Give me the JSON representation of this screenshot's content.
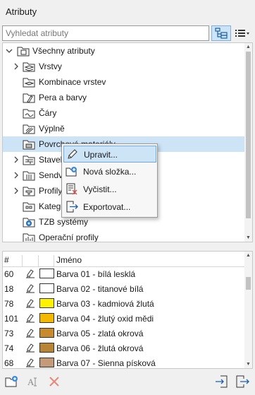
{
  "window": {
    "title": "Atributy"
  },
  "search": {
    "placeholder": "Vyhledat atributy",
    "value": ""
  },
  "toolbar": {
    "tree_view_icon": "tree-view-icon",
    "list_view_icon": "list-view-icon",
    "tree_view_active": true
  },
  "tree": {
    "root": {
      "label": "Všechny atributy",
      "expanded": true
    },
    "items": [
      {
        "label": "Vrstvy",
        "has_children": true,
        "icon": "layers-folder-icon"
      },
      {
        "label": "Kombinace vrstev",
        "has_children": false,
        "icon": "layer-combination-icon"
      },
      {
        "label": "Pera a barvy",
        "has_children": false,
        "icon": "pens-colors-icon"
      },
      {
        "label": "Čáry",
        "has_children": false,
        "icon": "line-types-icon"
      },
      {
        "label": "Výplně",
        "has_children": false,
        "icon": "fills-icon"
      },
      {
        "label": "Povrchové materiály",
        "has_children": false,
        "icon": "surfaces-icon",
        "selected": true
      },
      {
        "label": "Staveb",
        "has_children": true,
        "icon": "building-materials-icon"
      },
      {
        "label": "Sendv",
        "has_children": true,
        "icon": "composites-icon"
      },
      {
        "label": "Profily",
        "has_children": true,
        "icon": "profiles-icon"
      },
      {
        "label": "Katego",
        "has_children": false,
        "icon": "categories-icon"
      },
      {
        "label": "TZB systémy",
        "has_children": false,
        "icon": "mep-systems-icon"
      },
      {
        "label": "Operační profily",
        "has_children": false,
        "icon": "operation-profiles-icon"
      }
    ]
  },
  "context_menu": {
    "items": [
      {
        "label": "Upravit...",
        "icon": "edit-pencil-icon",
        "highlighted": true
      },
      {
        "label": "Nová složka...",
        "icon": "new-folder-icon",
        "highlighted": false
      },
      {
        "label": "Vyčistit...",
        "icon": "purge-icon",
        "highlighted": false
      },
      {
        "label": "Exportovat...",
        "icon": "export-icon",
        "highlighted": false
      }
    ]
  },
  "list": {
    "columns": {
      "index": "#",
      "name": "Jméno"
    },
    "rows": [
      {
        "index": "60",
        "name": "Barva 01 - bílá lesklá",
        "color": "#ffffff"
      },
      {
        "index": "18",
        "name": "Barva 02 - titanové bílá",
        "color": "#ffffff"
      },
      {
        "index": "78",
        "name": "Barva 03 - kadmiová žlutá",
        "color": "#fff200"
      },
      {
        "index": "101",
        "name": "Barva 04 - žlutý oxid mědi",
        "color": "#f5b800"
      },
      {
        "index": "73",
        "name": "Barva 05 - zlatá okrová",
        "color": "#c98a2e"
      },
      {
        "index": "74",
        "name": "Barva 06 - žlutá okrová",
        "color": "#b88436"
      },
      {
        "index": "68",
        "name": "Barva 07 - Sienna písková",
        "color": "#c49a78"
      }
    ]
  },
  "bottom_toolbar": {
    "new_folder_icon": "new-folder-icon",
    "rename_icon": "rename-icon",
    "delete_icon": "delete-icon",
    "import_icon": "import-icon",
    "export_icon": "export-icon"
  },
  "colors": {
    "selection": "#cde3f6",
    "accent": "#3d8ad6",
    "delete": "#e8887a"
  }
}
